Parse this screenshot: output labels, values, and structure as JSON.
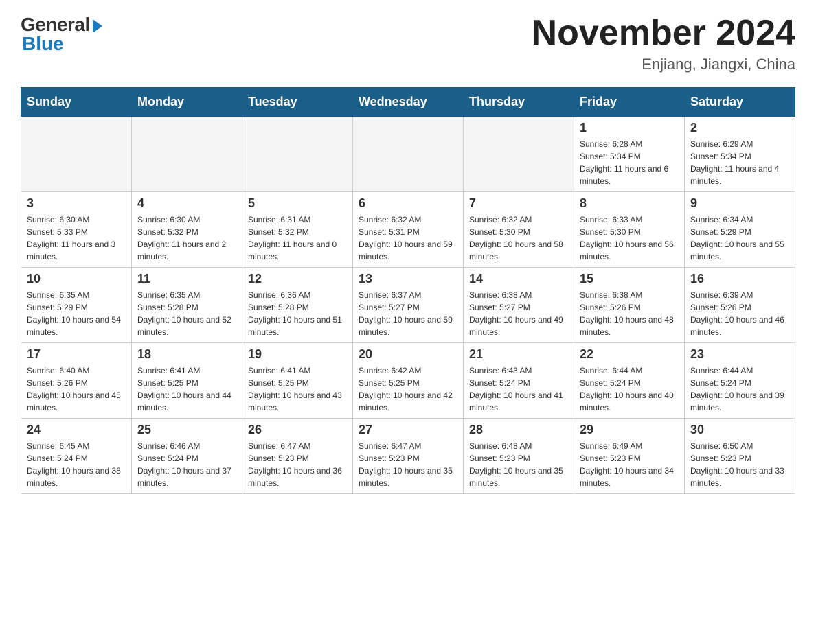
{
  "header": {
    "logo_general": "General",
    "logo_blue": "Blue",
    "title": "November 2024",
    "subtitle": "Enjiang, Jiangxi, China"
  },
  "weekdays": [
    "Sunday",
    "Monday",
    "Tuesday",
    "Wednesday",
    "Thursday",
    "Friday",
    "Saturday"
  ],
  "weeks": [
    [
      {
        "day": "",
        "info": ""
      },
      {
        "day": "",
        "info": ""
      },
      {
        "day": "",
        "info": ""
      },
      {
        "day": "",
        "info": ""
      },
      {
        "day": "",
        "info": ""
      },
      {
        "day": "1",
        "info": "Sunrise: 6:28 AM\nSunset: 5:34 PM\nDaylight: 11 hours and 6 minutes."
      },
      {
        "day": "2",
        "info": "Sunrise: 6:29 AM\nSunset: 5:34 PM\nDaylight: 11 hours and 4 minutes."
      }
    ],
    [
      {
        "day": "3",
        "info": "Sunrise: 6:30 AM\nSunset: 5:33 PM\nDaylight: 11 hours and 3 minutes."
      },
      {
        "day": "4",
        "info": "Sunrise: 6:30 AM\nSunset: 5:32 PM\nDaylight: 11 hours and 2 minutes."
      },
      {
        "day": "5",
        "info": "Sunrise: 6:31 AM\nSunset: 5:32 PM\nDaylight: 11 hours and 0 minutes."
      },
      {
        "day": "6",
        "info": "Sunrise: 6:32 AM\nSunset: 5:31 PM\nDaylight: 10 hours and 59 minutes."
      },
      {
        "day": "7",
        "info": "Sunrise: 6:32 AM\nSunset: 5:30 PM\nDaylight: 10 hours and 58 minutes."
      },
      {
        "day": "8",
        "info": "Sunrise: 6:33 AM\nSunset: 5:30 PM\nDaylight: 10 hours and 56 minutes."
      },
      {
        "day": "9",
        "info": "Sunrise: 6:34 AM\nSunset: 5:29 PM\nDaylight: 10 hours and 55 minutes."
      }
    ],
    [
      {
        "day": "10",
        "info": "Sunrise: 6:35 AM\nSunset: 5:29 PM\nDaylight: 10 hours and 54 minutes."
      },
      {
        "day": "11",
        "info": "Sunrise: 6:35 AM\nSunset: 5:28 PM\nDaylight: 10 hours and 52 minutes."
      },
      {
        "day": "12",
        "info": "Sunrise: 6:36 AM\nSunset: 5:28 PM\nDaylight: 10 hours and 51 minutes."
      },
      {
        "day": "13",
        "info": "Sunrise: 6:37 AM\nSunset: 5:27 PM\nDaylight: 10 hours and 50 minutes."
      },
      {
        "day": "14",
        "info": "Sunrise: 6:38 AM\nSunset: 5:27 PM\nDaylight: 10 hours and 49 minutes."
      },
      {
        "day": "15",
        "info": "Sunrise: 6:38 AM\nSunset: 5:26 PM\nDaylight: 10 hours and 48 minutes."
      },
      {
        "day": "16",
        "info": "Sunrise: 6:39 AM\nSunset: 5:26 PM\nDaylight: 10 hours and 46 minutes."
      }
    ],
    [
      {
        "day": "17",
        "info": "Sunrise: 6:40 AM\nSunset: 5:26 PM\nDaylight: 10 hours and 45 minutes."
      },
      {
        "day": "18",
        "info": "Sunrise: 6:41 AM\nSunset: 5:25 PM\nDaylight: 10 hours and 44 minutes."
      },
      {
        "day": "19",
        "info": "Sunrise: 6:41 AM\nSunset: 5:25 PM\nDaylight: 10 hours and 43 minutes."
      },
      {
        "day": "20",
        "info": "Sunrise: 6:42 AM\nSunset: 5:25 PM\nDaylight: 10 hours and 42 minutes."
      },
      {
        "day": "21",
        "info": "Sunrise: 6:43 AM\nSunset: 5:24 PM\nDaylight: 10 hours and 41 minutes."
      },
      {
        "day": "22",
        "info": "Sunrise: 6:44 AM\nSunset: 5:24 PM\nDaylight: 10 hours and 40 minutes."
      },
      {
        "day": "23",
        "info": "Sunrise: 6:44 AM\nSunset: 5:24 PM\nDaylight: 10 hours and 39 minutes."
      }
    ],
    [
      {
        "day": "24",
        "info": "Sunrise: 6:45 AM\nSunset: 5:24 PM\nDaylight: 10 hours and 38 minutes."
      },
      {
        "day": "25",
        "info": "Sunrise: 6:46 AM\nSunset: 5:24 PM\nDaylight: 10 hours and 37 minutes."
      },
      {
        "day": "26",
        "info": "Sunrise: 6:47 AM\nSunset: 5:23 PM\nDaylight: 10 hours and 36 minutes."
      },
      {
        "day": "27",
        "info": "Sunrise: 6:47 AM\nSunset: 5:23 PM\nDaylight: 10 hours and 35 minutes."
      },
      {
        "day": "28",
        "info": "Sunrise: 6:48 AM\nSunset: 5:23 PM\nDaylight: 10 hours and 35 minutes."
      },
      {
        "day": "29",
        "info": "Sunrise: 6:49 AM\nSunset: 5:23 PM\nDaylight: 10 hours and 34 minutes."
      },
      {
        "day": "30",
        "info": "Sunrise: 6:50 AM\nSunset: 5:23 PM\nDaylight: 10 hours and 33 minutes."
      }
    ]
  ]
}
